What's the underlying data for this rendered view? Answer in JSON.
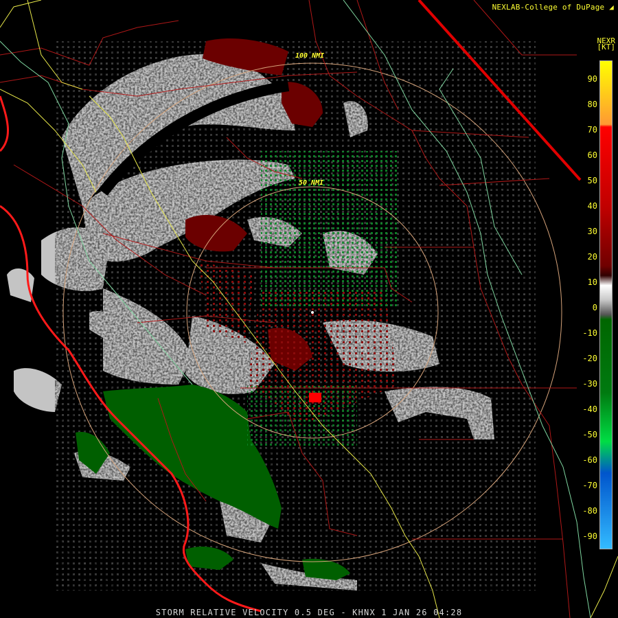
{
  "header": {
    "credit": "NEXLAB-College of DuPage",
    "credit_icon": "corner-logo-icon",
    "product": "NEXR",
    "unit": "[KT]"
  },
  "map": {
    "range_rings": [
      {
        "label": "100 NMI"
      },
      {
        "label": "50 NMI"
      }
    ],
    "colors": {
      "background": "#000000",
      "state_county_lines": "#b01818",
      "coast": "#ff1a1a",
      "highway": "#e8e84a",
      "river": "#7fd6a0",
      "ring": "#d6a37a"
    }
  },
  "legend": {
    "ticks": [
      "90",
      "80",
      "70",
      "60",
      "50",
      "40",
      "30",
      "20",
      "10",
      "0",
      "-10",
      "-20",
      "-30",
      "-40",
      "-50",
      "-60",
      "-70",
      "-80",
      "-90"
    ],
    "colors": {
      "high_inbound": "#ffff00",
      "peak": "#ff9933",
      "red": "#ff0000",
      "dark_red": "#700000",
      "zero": "#c8c8c8",
      "dark_green": "#006600",
      "green": "#00dd44",
      "blue": "#0055cc",
      "light_blue": "#33bbff"
    }
  },
  "footer": {
    "title": "STORM RELATIVE VELOCITY 0.5 DEG - KHNX 1 JAN 26 04:28"
  }
}
